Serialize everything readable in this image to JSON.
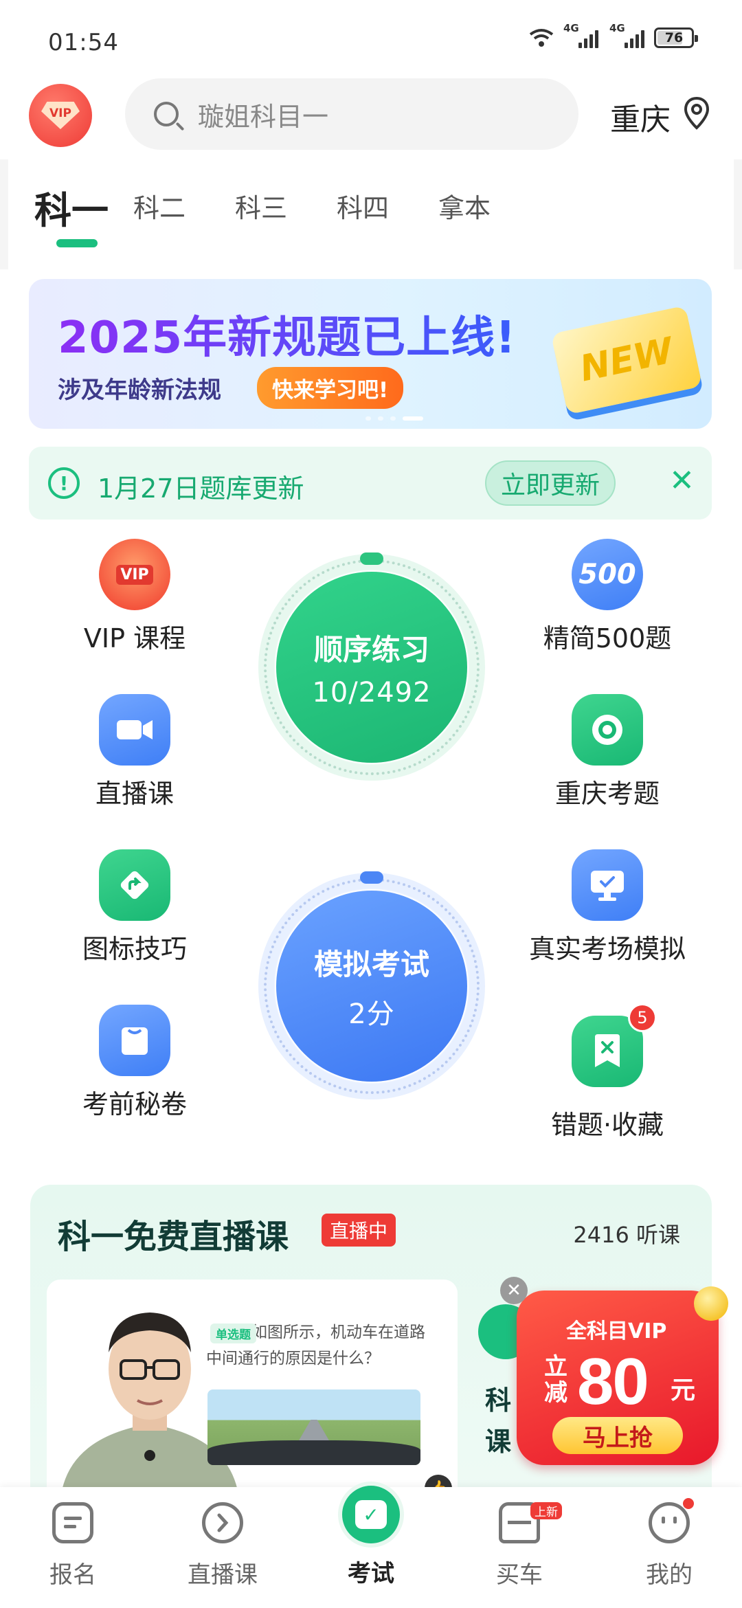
{
  "status_bar": {
    "time": "01:54",
    "net1": "4G",
    "net2": "4G",
    "battery": "76"
  },
  "header": {
    "vip_label": "VIP",
    "search_placeholder": "璇姐科目一",
    "city": "重庆"
  },
  "tabs": [
    {
      "label": "科一",
      "active": true
    },
    {
      "label": "科二"
    },
    {
      "label": "科三"
    },
    {
      "label": "科四"
    },
    {
      "label": "拿本"
    }
  ],
  "banner": {
    "title": "2025年新规题已上线!",
    "subtitle": "涉及年龄新法规",
    "button": "快来学习吧!",
    "badge": "NEW"
  },
  "notice": {
    "text": "1月27日题库更新",
    "button": "立即更新"
  },
  "features": {
    "vip_course": "VIP 课程",
    "vip_icon_text": "VIP",
    "live_course": "直播课",
    "icon_tips": "图标技巧",
    "exam_secret": "考前秘卷",
    "lite_500": "精简500题",
    "lite_500_icon": "500",
    "local_questions": "重庆考题",
    "real_exam_sim": "真实考场模拟",
    "mistakes": "错题·收藏",
    "mistakes_badge": "5"
  },
  "practice": {
    "title": "顺序练习",
    "progress": "10/2492"
  },
  "mock_exam": {
    "title": "模拟考试",
    "score": "2分"
  },
  "live_section": {
    "title": "科一免费直播课",
    "tag": "直播中",
    "listeners": "2416 听课",
    "question_tag": "单选题",
    "question_text": "如图所示，机动车在道路中间通行的原因是什么？",
    "side_text": "科课"
  },
  "promo": {
    "top": "全科目VIP",
    "prefix": "立减",
    "amount": "80",
    "unit": "元",
    "button": "马上抢"
  },
  "bottom_nav": [
    {
      "label": "报名"
    },
    {
      "label": "直播课"
    },
    {
      "label": "考试",
      "active": true
    },
    {
      "label": "买车",
      "tag": "上新"
    },
    {
      "label": "我的"
    }
  ]
}
